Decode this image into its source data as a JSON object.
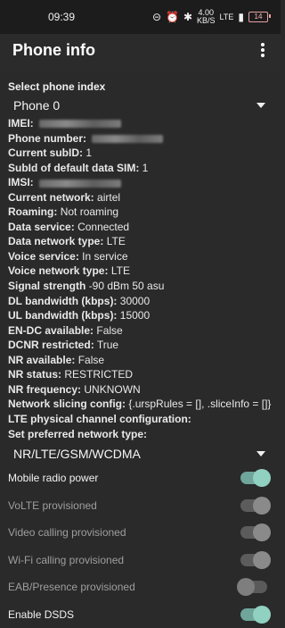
{
  "status_bar": {
    "time": "09:39",
    "speed": "4.00",
    "speed_unit": "KB/S",
    "network": "LTE",
    "battery": "14"
  },
  "app_bar": {
    "title": "Phone info"
  },
  "phone_index": {
    "label": "Select phone index",
    "value": "Phone 0"
  },
  "info": [
    {
      "key": "IMEI:",
      "value": "",
      "redacted": true
    },
    {
      "key": "Phone number:",
      "value": "",
      "redacted": true
    },
    {
      "key": "Current subID:",
      "value": "1"
    },
    {
      "key": "SubId of default data SIM:",
      "value": "1"
    },
    {
      "key": "IMSI:",
      "value": "",
      "redacted": true
    },
    {
      "key": "Current network:",
      "value": "airtel"
    },
    {
      "key": "Roaming:",
      "value": "Not roaming"
    },
    {
      "key": "Data service:",
      "value": "Connected"
    },
    {
      "key": "Data network type:",
      "value": "LTE"
    },
    {
      "key": "Voice service:",
      "value": "In service"
    },
    {
      "key": "Voice network type:",
      "value": "LTE"
    },
    {
      "key": "Signal strength",
      "value": "-90 dBm   50 asu"
    },
    {
      "key": "DL bandwidth (kbps):",
      "value": "30000"
    },
    {
      "key": "UL bandwidth (kbps):",
      "value": "15000"
    },
    {
      "key": "EN-DC available:",
      "value": "False"
    },
    {
      "key": "DCNR restricted:",
      "value": "True"
    },
    {
      "key": "NR available:",
      "value": "False"
    },
    {
      "key": "NR status:",
      "value": "RESTRICTED"
    },
    {
      "key": "NR frequency:",
      "value": "UNKNOWN"
    },
    {
      "key": "Network slicing config:",
      "value": "{.urspRules = [], .sliceInfo = []}"
    },
    {
      "key": "LTE physical channel configuration:",
      "value": ""
    }
  ],
  "preferred_network": {
    "label": "Set preferred network type:",
    "value": "NR/LTE/GSM/WCDMA"
  },
  "switches": [
    {
      "label": "Mobile radio power",
      "state": "on",
      "enabled": true
    },
    {
      "label": "VoLTE provisioned",
      "state": "on",
      "enabled": false
    },
    {
      "label": "Video calling provisioned",
      "state": "on",
      "enabled": false
    },
    {
      "label": "Wi-Fi calling provisioned",
      "state": "on",
      "enabled": false
    },
    {
      "label": "EAB/Presence provisioned",
      "state": "off",
      "enabled": false
    },
    {
      "label": "Enable DSDS",
      "state": "on",
      "enabled": true
    }
  ],
  "colors": {
    "background": "#2a2a2a",
    "status_bar": "#1c1c1c",
    "accent_toggle": "#91d1c2",
    "battery_low": "#e7a2a2"
  }
}
